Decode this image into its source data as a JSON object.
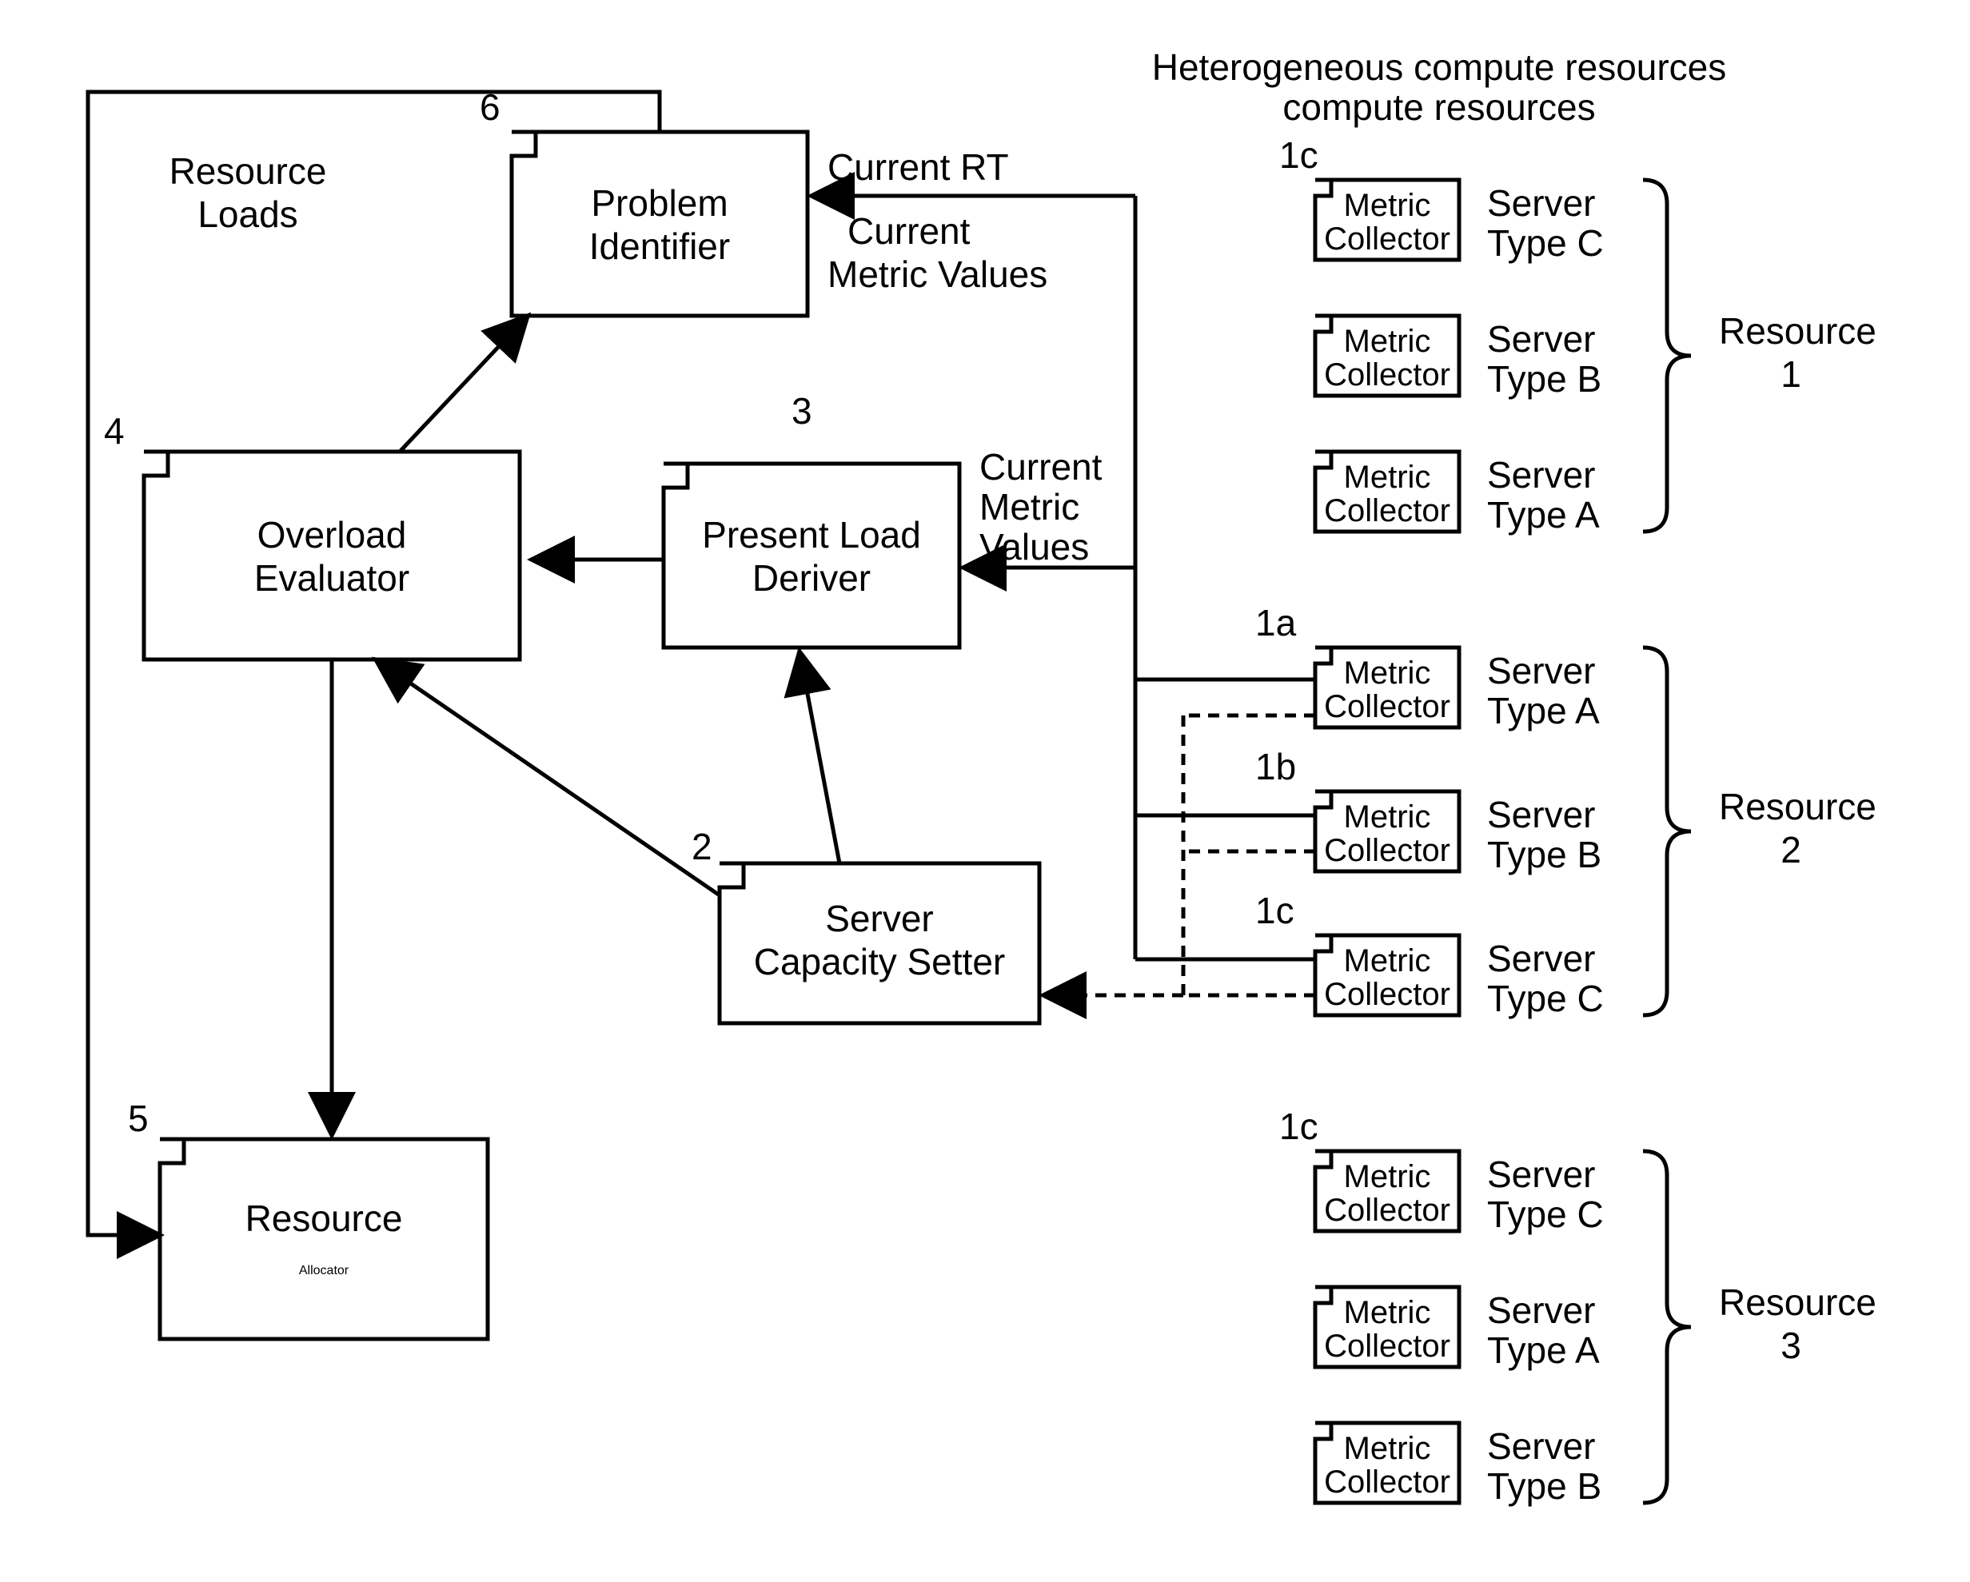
{
  "title": "Heterogeneous compute resources",
  "labels": {
    "resLoads1": "Resource",
    "resLoads2": "Loads",
    "currentRT": "Current RT",
    "currentMetric1": "Current",
    "currentMetric2": "Metric Values",
    "currentMetric3a": "Current",
    "currentMetric3b": "Metric",
    "currentMetric3c": "Values"
  },
  "blocks": {
    "problem1": "Problem",
    "problem2": "Identifier",
    "overload1": "Overload",
    "overload2": "Evaluator",
    "present1": "Present Load",
    "present2": "Deriver",
    "server1": "Server",
    "server2": "Capacity Setter",
    "resource1": "Resource",
    "resource2": "Allocator",
    "metric1": "Metric",
    "metric2": "Collector"
  },
  "serverTypes": {
    "c1": "Server",
    "c2": "Type C",
    "b1": "Server",
    "b2": "Type B",
    "a1": "Server",
    "a2": "Type A"
  },
  "resources": {
    "r1a": "Resource",
    "r1b": "1",
    "r2a": "Resource",
    "r2b": "2",
    "r3a": "Resource",
    "r3b": "3"
  },
  "nums": {
    "n2": "2",
    "n3": "3",
    "n4": "4",
    "n5": "5",
    "n6": "6",
    "n1a": "1a",
    "n1b": "1b",
    "n1c": "1c",
    "n1c_top": "1c",
    "n1c_bot": "1c"
  }
}
